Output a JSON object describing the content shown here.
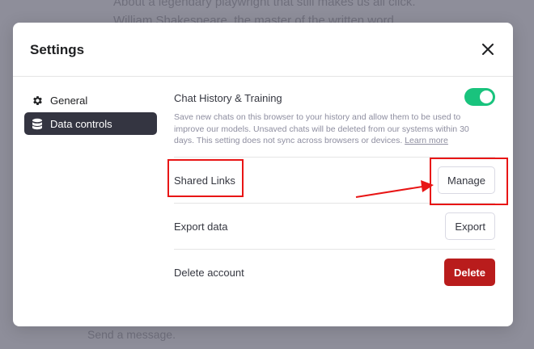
{
  "background": {
    "line1": "About a legendary playwright that still makes us all click.",
    "line2": "William Shakespeare, the master of the written word,",
    "input_placeholder": "Send a message."
  },
  "modal": {
    "title": "Settings",
    "close_icon": "close-icon"
  },
  "sidebar": {
    "items": [
      {
        "label": "General",
        "icon": "gear-icon",
        "active": false
      },
      {
        "label": "Data controls",
        "icon": "database-icon",
        "active": true
      }
    ]
  },
  "chat_history": {
    "title": "Chat History & Training",
    "toggle_on": true,
    "description": "Save new chats on this browser to your history and allow them to be used to improve our models. Unsaved chats will be deleted from our systems within 30 days. This setting does not sync across browsers or devices.",
    "learn_more": "Learn more"
  },
  "shared_links": {
    "label": "Shared Links",
    "button": "Manage"
  },
  "export_data": {
    "label": "Export data",
    "button": "Export"
  },
  "delete_account": {
    "label": "Delete account",
    "button": "Delete"
  },
  "colors": {
    "toggle_on": "#19c37d",
    "active_item": "#343541",
    "delete_button": "#b91c1c",
    "annotation": "#e81515"
  }
}
